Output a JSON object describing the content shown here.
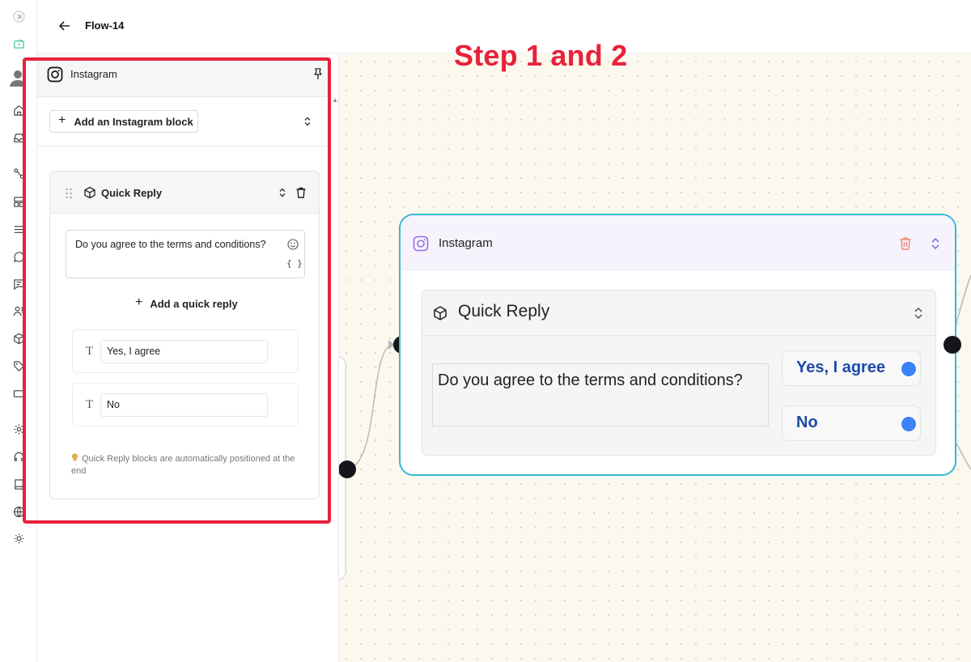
{
  "topbar": {
    "back_label": "←",
    "flow_title": "Flow-14"
  },
  "annotation": {
    "step_label": "Step 1 and 2"
  },
  "rail": {
    "icons": [
      "sidebar-expand-icon",
      "chat-bot-icon",
      "user-avatar-icon",
      "home-icon",
      "inbox-icon",
      "flow-icon",
      "layout-icon",
      "list-icon",
      "chat-bubble-icon",
      "message-icon",
      "contacts-icon",
      "package-icon",
      "tag-icon",
      "ticket-icon",
      "settings-icon",
      "headset-icon",
      "book-icon",
      "globe-icon",
      "theme-icon"
    ]
  },
  "panel": {
    "title": "Instagram",
    "add_block_label": "Add an Instagram block",
    "block": {
      "title": "Quick Reply",
      "message": "Do you agree to the terms and conditions?",
      "variables_label": "{ }",
      "add_quick_reply_label": "Add a quick reply",
      "options": [
        {
          "type_icon": "T",
          "value": "Yes, I agree"
        },
        {
          "type_icon": "T",
          "value": "No"
        }
      ],
      "hint": "Quick Reply blocks are automatically positioned at the end"
    }
  },
  "node": {
    "title": "Instagram",
    "block_title": "Quick Reply",
    "message": "Do you agree to the terms and conditions?",
    "options": [
      "Yes, I agree",
      "No"
    ]
  },
  "colors": {
    "annotation_red": "#e8213b",
    "node_border": "#35b9d6",
    "option_text": "#1f4aa7",
    "port_blue": "#3b82f6",
    "canvas_bg": "#fcf8ee"
  }
}
